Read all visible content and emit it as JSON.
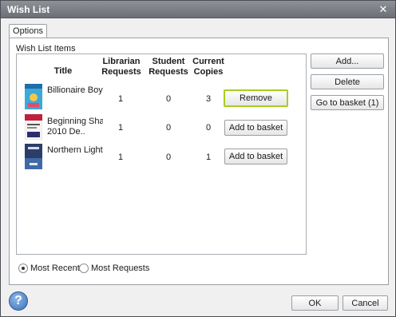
{
  "window": {
    "title": "Wish List"
  },
  "tabs": [
    {
      "label": "Options"
    }
  ],
  "group_label": "Wish List Items",
  "columns": {
    "title": "Title",
    "librarian_requests": [
      "Librarian",
      "Requests"
    ],
    "student_requests": [
      "Student",
      "Requests"
    ],
    "current_copies": [
      "Current",
      "Copies"
    ]
  },
  "items": [
    {
      "title": [
        "Billionaire Boy",
        ""
      ],
      "librarian": "1",
      "student": "0",
      "copies": "3",
      "action": "Remove"
    },
    {
      "title": [
        "Beginning Sha",
        "2010 De.."
      ],
      "librarian": "1",
      "student": "0",
      "copies": "0",
      "action": "Add to basket"
    },
    {
      "title": [
        "Northern Light",
        ""
      ],
      "librarian": "1",
      "student": "0",
      "copies": "1",
      "action": "Add to basket"
    }
  ],
  "side_buttons": {
    "add": "Add...",
    "delete": "Delete",
    "go_to_basket": "Go to basket (1)"
  },
  "sort": {
    "most_recent": "Most Recent",
    "most_requests": "Most Requests",
    "selected": "most_recent"
  },
  "footer": {
    "ok": "OK",
    "cancel": "Cancel"
  },
  "icons": {
    "help": "help-icon",
    "close": "close-icon"
  },
  "colors": {
    "focus_border": "#a6cf1e",
    "titlebar": "#7a7e84"
  }
}
